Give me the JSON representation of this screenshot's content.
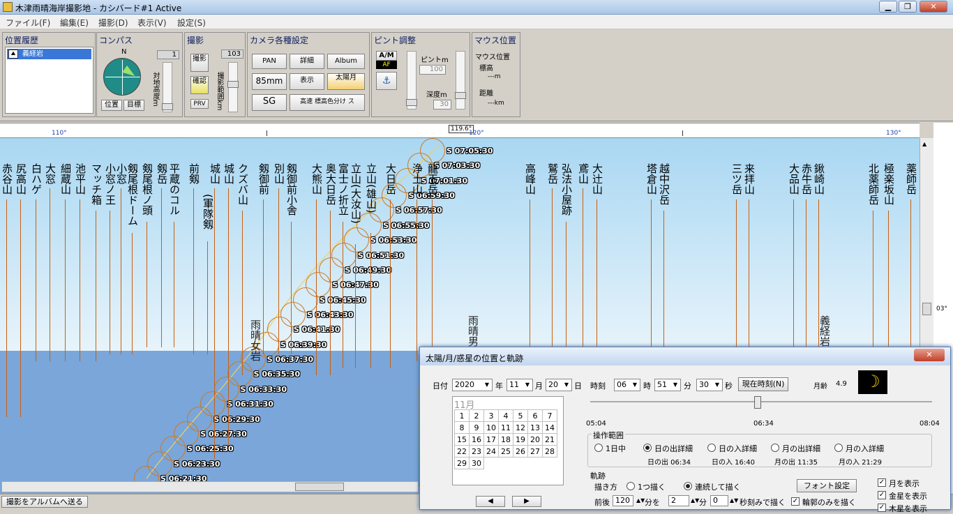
{
  "window": {
    "title": "木津雨晴海岸撮影地 - カシバード#1 Active",
    "minimize": "▁",
    "restore": "❐",
    "close": "✕"
  },
  "menu": [
    "ファイル(F)",
    "編集(E)",
    "撮影(D)",
    "表示(V)",
    "設定(S)"
  ],
  "panels": {
    "history": {
      "title": "位置履歴",
      "item": "義経岩"
    },
    "compass": {
      "title": "コンパス",
      "north": "N",
      "value": "1",
      "label": "対地高度m",
      "btn_pos": "位置",
      "btn_target": "目標"
    },
    "shoot": {
      "title": "撮影",
      "btn_shoot": "撮影",
      "btn_confirm": "確認",
      "btn_prv": "PRV",
      "value": "103",
      "label": "撮影範囲km"
    },
    "camera": {
      "title": "カメラ各種設定",
      "pan": "PAN",
      "detail": "詳細",
      "album": "Album",
      "mm85": "85mm",
      "display": "表示",
      "sunmoon": "太陽月",
      "sg": "SG",
      "fast": "高速 標高色分け ス"
    },
    "focus": {
      "title": "ピント調整",
      "am": "A/M",
      "af": "AF",
      "focus_label": "ピントm",
      "focus_value": "100",
      "depth_label": "深度m",
      "depth_value": "30"
    },
    "mouse": {
      "title": "マウス位置",
      "alt_label": "標高",
      "alt_value": "---m",
      "dist_label": "距離",
      "dist_value": "---km"
    }
  },
  "ruler": {
    "t110": "110°",
    "t1196": "119.6°",
    "t120": "120°",
    "t130": "130°",
    "right": "03°"
  },
  "peaks": [
    "赤谷山",
    "尻高山",
    "白ハゲ",
    "大窓",
    "細蔵山",
    "池平山",
    "マッチ箱",
    "小窓ノ王",
    "小窓",
    "剱尾根ドーム",
    "剱尾根ノ頭",
    "剱岳",
    "平蔵のコル",
    "前剱",
    "(軍隊剱",
    "城山",
    "城山",
    "クズバ山",
    "剱御前",
    "別山",
    "剱御前小舎",
    "大熊山",
    "奥大日岳",
    "富士ノ折立",
    "立山(大汝山)",
    "立山(雄山)",
    "大日岳",
    "浄土山",
    "龍王岳",
    "高峰山",
    "鷲岳",
    "弘法小屋跡",
    "鳶山",
    "大辻山",
    "塔倉山",
    "越中沢岳",
    "三ツ岳",
    "来拝山",
    "大品山",
    "赤牛岳",
    "鍬崎山",
    "北薬師岳",
    "極楽坂山",
    "薬師岳"
  ],
  "sun_times": [
    "S 07:05:30",
    "S 07:03:30",
    "S 07:01:30",
    "S 06:59:30",
    "S 06:57:30",
    "S 06:55:30",
    "S 06:53:30",
    "S 06:51:30",
    "S 06:49:30",
    "S 06:47:30",
    "S 06:45:30",
    "S 06:43:30",
    "S 06:41:30",
    "S 06:39:30",
    "S 06:37:30",
    "S 06:35:30",
    "S 06:33:30",
    "S 06:31:30",
    "S 06:29:30",
    "S 06:27:30",
    "S 06:25:30",
    "S 06:23:30",
    "S 06:21:30"
  ],
  "view_labels": {
    "a": "雨晴女岩",
    "b": "雨晴男",
    "c": "義経岩"
  },
  "status": "撮影をアルバムへ送る",
  "dialog": {
    "title": "太陽/月/惑星の位置と軌跡",
    "date_label": "日付",
    "year": "2020",
    "year_unit": "年",
    "month": "11",
    "month_unit": "月",
    "day": "20",
    "day_unit": "日",
    "time_label": "時刻",
    "hour": "06",
    "hour_unit": "時",
    "minute": "51",
    "minute_unit": "分",
    "second": "30",
    "second_unit": "秒",
    "now_button": "現在時刻(N)",
    "moon_age_label": "月齢",
    "moon_age": "4.9",
    "calendar_header": "11月",
    "calendar": [
      [
        "1",
        "2",
        "3",
        "4",
        "5",
        "6",
        "7"
      ],
      [
        "8",
        "9",
        "10",
        "11",
        "12",
        "13",
        "14"
      ],
      [
        "15",
        "16",
        "17",
        "18",
        "19",
        "20",
        "21"
      ],
      [
        "22",
        "23",
        "24",
        "25",
        "26",
        "27",
        "28"
      ],
      [
        "29",
        "30",
        "",
        "",
        "",
        "",
        ""
      ]
    ],
    "slider_start": "05:04",
    "slider_mid": "06:34",
    "slider_end": "08:04",
    "slider_position": 0.49,
    "range_title": "操作範囲",
    "range_opts": [
      "1日中",
      "日の出詳細",
      "日の入詳細",
      "月の出詳細",
      "月の入詳細"
    ],
    "range_vals": [
      "日の出 06:34",
      "日の入 16:40",
      "月の出 11:35",
      "月の入 21:29"
    ],
    "track_title": "軌跡",
    "draw_label": "描き方",
    "draw_once": "1つ描く",
    "draw_cont": "連続して描く",
    "font_button": "フォント設定",
    "before_after": "前後",
    "ba_val": "120",
    "min_wo": "分を",
    "step_val": "2",
    "step_min": "分",
    "sec_val": "0",
    "sec_draw": "秒刻みで描く",
    "outline_only": "輪郭のみを描く",
    "show_moon": "月を表示",
    "show_venus": "金星を表示",
    "show_jupiter": "木星を表示",
    "prev": "◀",
    "next": "▶"
  },
  "colors": {
    "sky": "#7aa6d9",
    "sun_track": "#d07820",
    "leader": "#c86010"
  }
}
